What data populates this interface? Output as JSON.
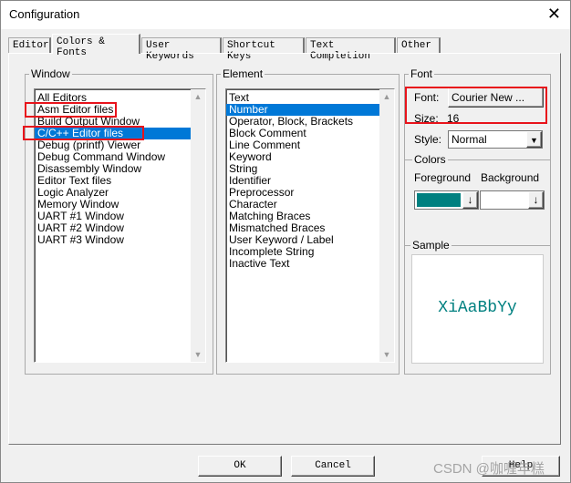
{
  "window": {
    "title": "Configuration",
    "close": "✕"
  },
  "tabs": [
    "Editor",
    "Colors & Fonts",
    "User Keywords",
    "Shortcut Keys",
    "Text Completion",
    "Other"
  ],
  "window_group": {
    "label": "Window",
    "items": [
      "All Editors",
      "Asm Editor files",
      "Build Output Window",
      "C/C++ Editor files",
      "Debug (printf) Viewer",
      "Debug Command Window",
      "Disassembly Window",
      "Editor Text files",
      "Logic Analyzer",
      "Memory Window",
      "UART #1 Window",
      "UART #2 Window",
      "UART #3 Window"
    ],
    "selected": "C/C++ Editor files"
  },
  "element_group": {
    "label": "Element",
    "items": [
      "Text",
      "Number",
      "Operator, Block, Brackets",
      "Block Comment",
      "Line Comment",
      "Keyword",
      "String",
      "Identifier",
      "Preprocessor",
      "Character",
      "Matching Braces",
      "Mismatched Braces",
      "User Keyword / Label",
      "Incomplete String",
      "Inactive Text"
    ],
    "selected": "Number"
  },
  "font_group": {
    "label": "Font",
    "font_label": "Font:",
    "font_value": "Courier New ...",
    "size_label": "Size:",
    "size_value": "16",
    "style_label": "Style:",
    "style_value": "Normal"
  },
  "colors_group": {
    "label": "Colors",
    "foreground_label": "Foreground",
    "background_label": "Background",
    "foreground_color": "#008080",
    "background_color": "#ffffff"
  },
  "sample_group": {
    "label": "Sample",
    "text": "XiAaBbYy",
    "color": "#008080"
  },
  "buttons": {
    "ok": "OK",
    "cancel": "Cancel",
    "help": "Help"
  },
  "watermark": "CSDN @咖喱年糕"
}
